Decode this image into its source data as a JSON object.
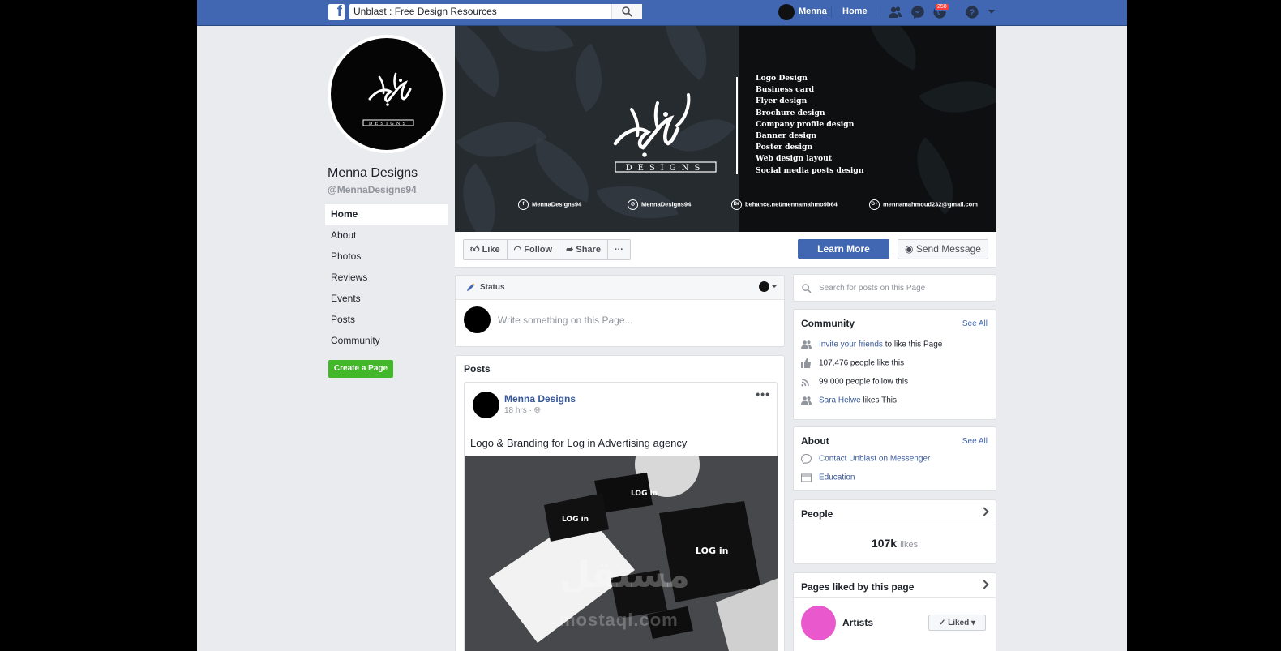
{
  "topbar": {
    "search_value": "Unblast : Free Design Resources",
    "user_name": "Menna",
    "home_label": "Home",
    "notif_badge": "258"
  },
  "page": {
    "name": "Menna Designs",
    "handle": "@MennaDesigns94",
    "nav": [
      "Home",
      "About",
      "Photos",
      "Reviews",
      "Events",
      "Posts",
      "Community"
    ],
    "create_page": "Create a Page"
  },
  "cover": {
    "brand_word": "DESIGNS",
    "services": [
      "Logo Design",
      "Business card",
      "Flyer design",
      "Brochure design",
      "Company profile design",
      "Banner design",
      "Poster design",
      "Web design layout",
      "Social media posts design"
    ],
    "socials": {
      "facebook": "MennaDesigns94",
      "instagram": "MennaDesigns94",
      "behance": "behance.net/mennamahmo9b64",
      "email": "mennamahmoud232@gmail.com"
    },
    "behance_icon": "Be",
    "gplus_icon": "G+"
  },
  "actions": {
    "like": "Like",
    "follow": "Follow",
    "share": "Share",
    "more": "···",
    "learn_more": "Learn More",
    "send_message": "Send Message"
  },
  "composer": {
    "status_label": "Status",
    "placeholder": "Write something on this Page..."
  },
  "posts": {
    "title": "Posts",
    "author": "Menna Designs",
    "time": "18 hrs",
    "text": "Logo & Branding for Log in Advertising agency",
    "more": "•••"
  },
  "sidebar": {
    "search_placeholder": "Search for posts on this Page",
    "community": {
      "title": "Community",
      "see_all": "See All",
      "invite_link": "Invite your friends",
      "invite_rest": " to like this Page",
      "likes": "107,476 people like this",
      "follows": "99,000 people follow this",
      "friend_link": "Sara Helwe",
      "friend_rest": " likes This"
    },
    "about": {
      "title": "About",
      "see_all": "See All",
      "contact": "Contact Unblast on Messenger",
      "category": "Education"
    },
    "people": {
      "title": "People",
      "count": "107k",
      "unit": "likes"
    },
    "pages_liked": {
      "title": "Pages liked by this page",
      "page_name": "Artists",
      "liked_label": "✓ Liked ▾"
    }
  },
  "watermark": {
    "arabic": "مستقل",
    "latin": "mostaql.com"
  },
  "colors": {
    "brand_blue": "#4267b2",
    "green": "#42b72a",
    "link": "#365899",
    "artist_avatar": "#e958cc"
  }
}
